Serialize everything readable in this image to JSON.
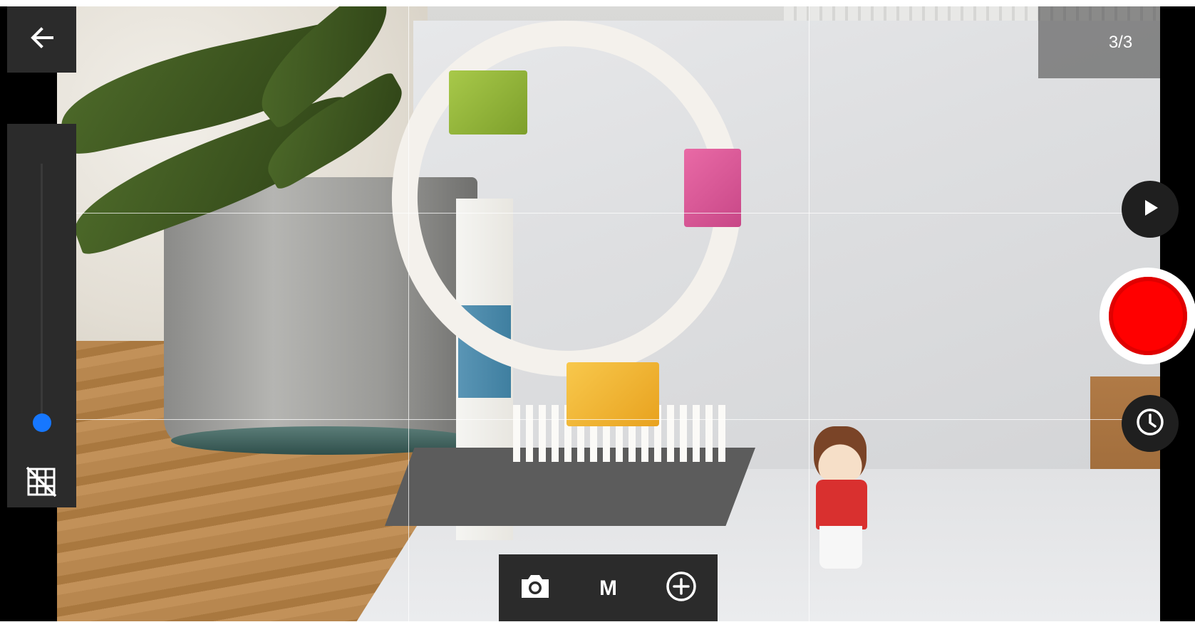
{
  "app": {
    "frame_counter": "3/3"
  },
  "left_panel": {
    "back_icon": "arrow-left-icon",
    "zoom_slider": {
      "level": 0.05
    },
    "grid_toggle_icon": "grid-off-icon"
  },
  "right_panel": {
    "play_icon": "play-icon",
    "record_icon": "record-icon",
    "timer_icon": "clock-icon"
  },
  "bottom_toolbar": {
    "camera_icon": "camera-icon",
    "mode_label": "M",
    "add_icon": "add-circle-icon"
  },
  "colors": {
    "panel": "#2b2b2b",
    "accent": "#1677ff",
    "record": "#ff0000"
  }
}
